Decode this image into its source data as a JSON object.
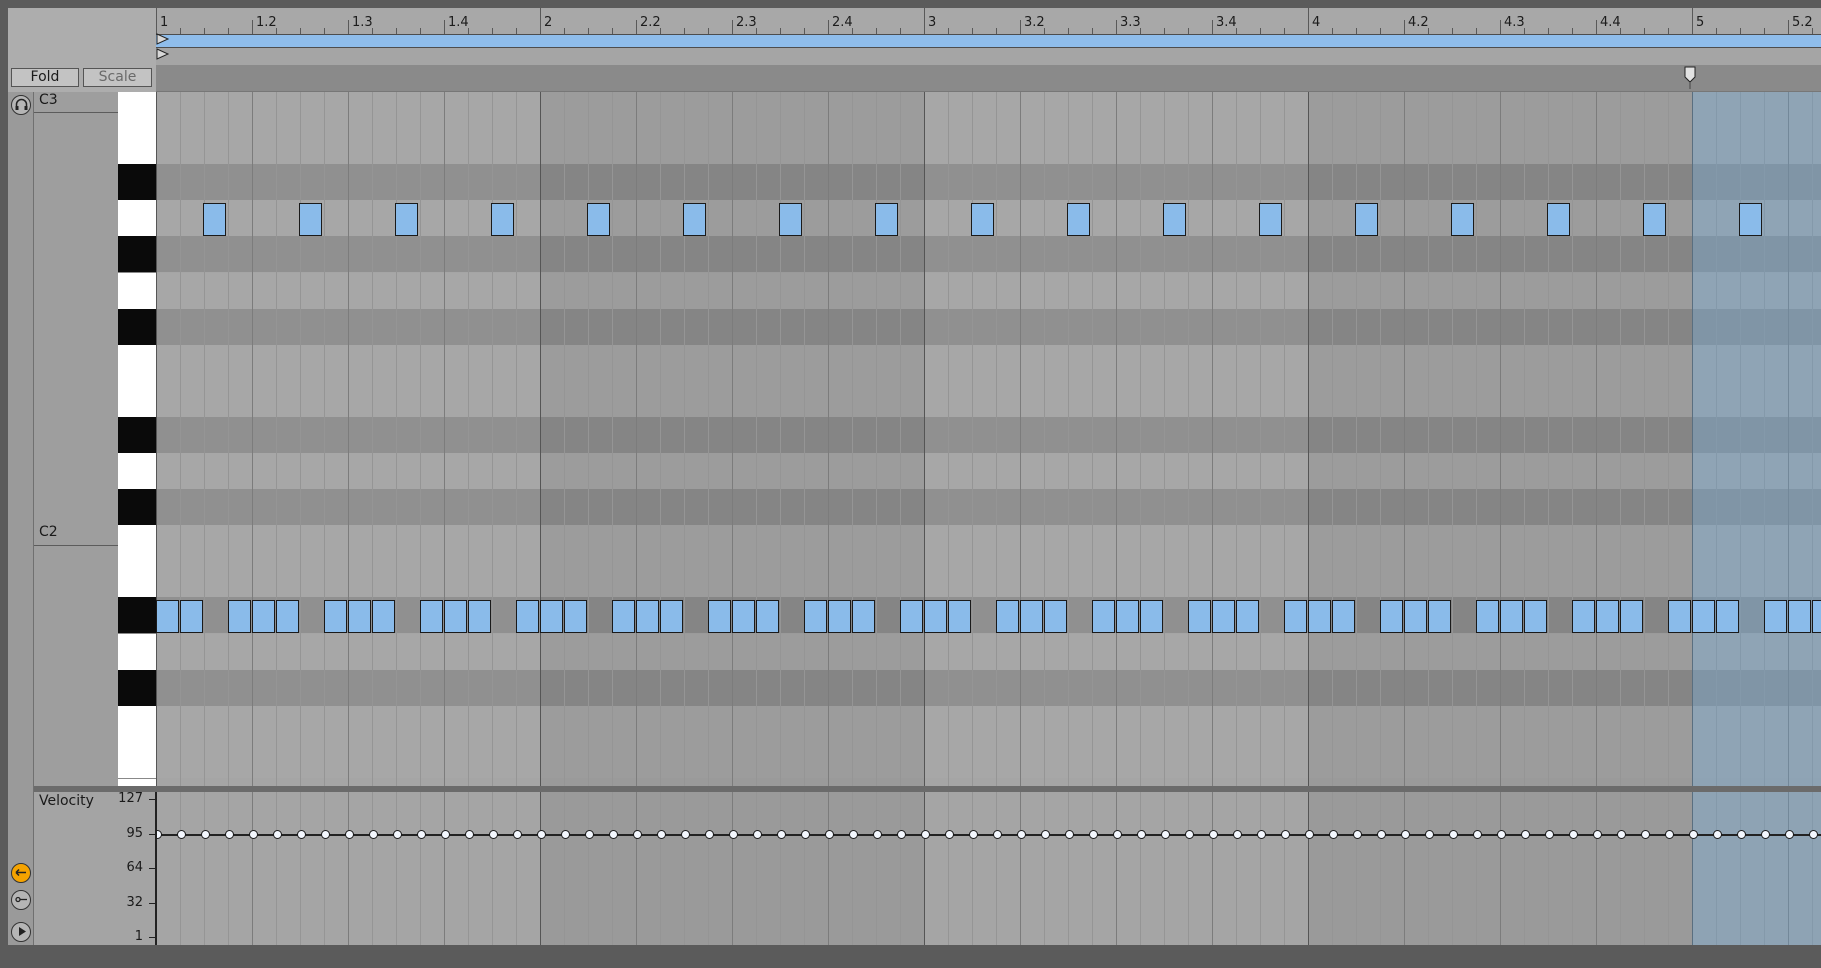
{
  "buttons": {
    "fold": "Fold",
    "scale": "Scale"
  },
  "ruler_labels": [
    "1",
    "1.2",
    "1.3",
    "1.4",
    "2",
    "2.2",
    "2.3",
    "2.4",
    "3",
    "3.2",
    "3.3",
    "3.4",
    "4",
    "4.2",
    "4.3",
    "4.4",
    "5",
    "5.2"
  ],
  "octave_labels": {
    "upper": "C3",
    "lower": "C2"
  },
  "velocity": {
    "title": "Velocity",
    "scale_labels": [
      "127",
      "95",
      "64",
      "32",
      "1"
    ],
    "note_value": 95
  },
  "colors": {
    "note_fill": "#8abbea",
    "loop_bar": "#8fbdeb",
    "selection": "#6ea0c8",
    "active_icon": "#f5a300"
  },
  "icons": {
    "headphone": "headphone-icon",
    "draw_mode": "draw-mode-icon",
    "link": "link-icon",
    "play": "play-icon"
  }
}
